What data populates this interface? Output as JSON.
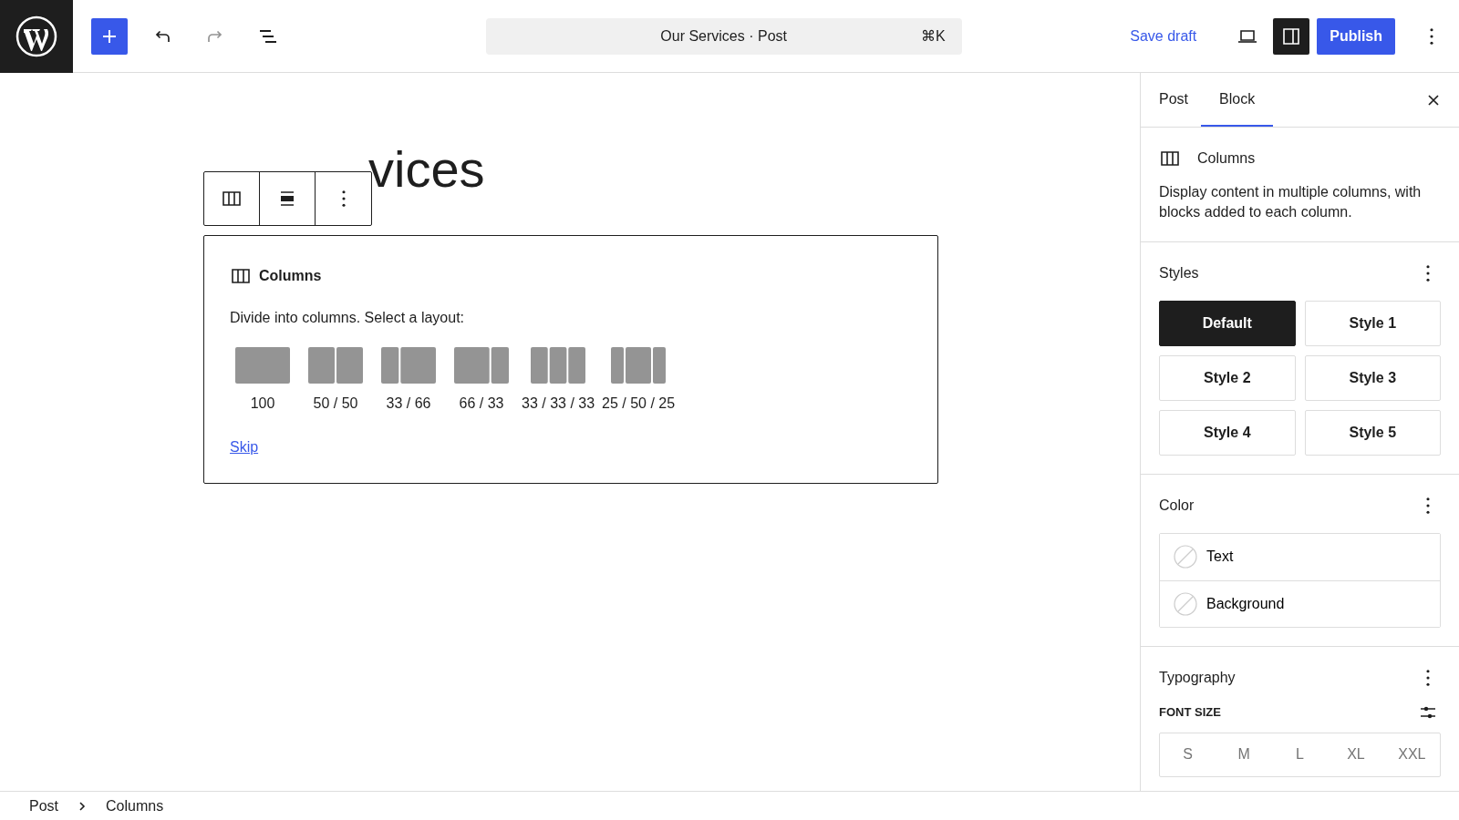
{
  "topbar": {
    "document_title": "Our Services · Post",
    "shortcut": "⌘K",
    "save_draft": "Save draft",
    "publish": "Publish",
    "undo_disabled": false,
    "redo_disabled": true,
    "sidebar_toggle_on": true
  },
  "editor": {
    "post_title": "vices",
    "placeholder": {
      "block_name": "Columns",
      "instructions": "Divide into columns. Select a layout:",
      "skip": "Skip",
      "layouts": [
        {
          "label": "100",
          "kind": "full"
        },
        {
          "label": "50 / 50",
          "kind": "halves"
        },
        {
          "label": "33 / 66",
          "kind": "narrow-wide"
        },
        {
          "label": "66 / 33",
          "kind": "wide-narrow"
        },
        {
          "label": "33 / 33 / 33",
          "kind": "thirds"
        },
        {
          "label": "25 / 50 / 25",
          "kind": "wide-center"
        }
      ]
    }
  },
  "sidebar": {
    "tabs": [
      {
        "label": "Post",
        "selected": false
      },
      {
        "label": "Block",
        "selected": true
      }
    ],
    "block": {
      "name": "Columns",
      "description": "Display content in multiple columns, with blocks added to each column."
    },
    "styles": {
      "title": "Styles",
      "options": [
        {
          "label": "Default",
          "selected": true
        },
        {
          "label": "Style 1",
          "selected": false
        },
        {
          "label": "Style 2",
          "selected": false
        },
        {
          "label": "Style 3",
          "selected": false
        },
        {
          "label": "Style 4",
          "selected": false
        },
        {
          "label": "Style 5",
          "selected": false
        }
      ]
    },
    "color": {
      "title": "Color",
      "items": [
        {
          "label": "Text"
        },
        {
          "label": "Background"
        }
      ]
    },
    "typography": {
      "title": "Typography",
      "font_size_label": "FONT SIZE",
      "sizes": [
        {
          "label": "S",
          "selected": false
        },
        {
          "label": "M",
          "selected": false
        },
        {
          "label": "L",
          "selected": false
        },
        {
          "label": "XL",
          "selected": false
        },
        {
          "label": "XXL",
          "selected": false
        }
      ]
    }
  },
  "breadcrumb": [
    {
      "label": "Post"
    },
    {
      "label": "Columns"
    }
  ]
}
